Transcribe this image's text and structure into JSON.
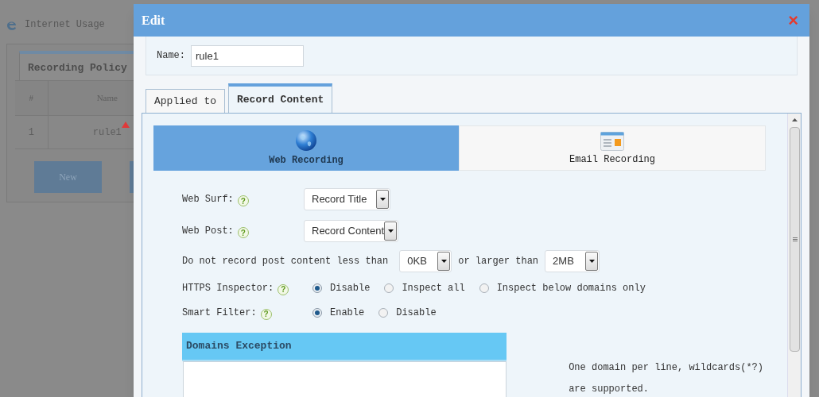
{
  "background_page": {
    "title": "Internet Usage",
    "tab": "Recording Policy",
    "table": {
      "columns": [
        "#",
        "Name"
      ],
      "rows": [
        [
          "1",
          "rule1"
        ]
      ]
    },
    "buttons": [
      "New"
    ]
  },
  "dialog": {
    "title": "Edit",
    "close": "×",
    "name_label": "Name:",
    "name_value": "rule1",
    "tabs": [
      {
        "label": "Applied to",
        "selected": false
      },
      {
        "label": "Record Content",
        "selected": true
      }
    ],
    "record_types": [
      {
        "label": "Web Recording",
        "kind": "web",
        "selected": true
      },
      {
        "label": "Email Recording",
        "kind": "email",
        "selected": false
      }
    ],
    "settings": [
      {
        "kind": "select",
        "label": "Web Surf:",
        "help": "?",
        "value": "Record Title"
      },
      {
        "kind": "select",
        "label": "Web Post:",
        "help": "?",
        "value": "Record Content"
      },
      {
        "kind": "range",
        "label": "Do not record post content less than",
        "min": "0KB",
        "middle": "or larger than",
        "max": "2MB"
      },
      {
        "kind": "radio",
        "label": "HTTPS Inspector:",
        "help": "?",
        "options": [
          {
            "label": "Disable",
            "selected": true
          },
          {
            "label": "Inspect all",
            "selected": false
          },
          {
            "label": "Inspect below domains only",
            "selected": false
          }
        ]
      },
      {
        "kind": "radio",
        "label": "Smart Filter:",
        "help": "?",
        "options": [
          {
            "label": "Enable",
            "selected": true
          },
          {
            "label": "Disable",
            "selected": false
          }
        ]
      }
    ],
    "domains_exception": {
      "title": "Domains Exception",
      "note": "One domain per line, wildcards(*?) are supported."
    }
  }
}
